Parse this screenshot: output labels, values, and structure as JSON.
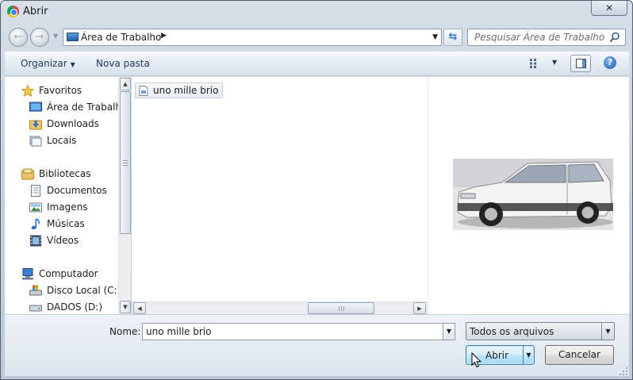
{
  "window": {
    "title": "Abrir",
    "close_label": "✕"
  },
  "address": {
    "location": "Área de Trabalho",
    "search_placeholder": "Pesquisar Área de Trabalho"
  },
  "toolbar": {
    "organize": "Organizar",
    "new_folder": "Nova pasta"
  },
  "tree": {
    "favorites": "Favoritos",
    "desktop": "Área de Trabalho",
    "downloads": "Downloads",
    "places": "Locais",
    "libraries": "Bibliotecas",
    "documents": "Documentos",
    "images": "Imagens",
    "music": "Músicas",
    "videos": "Vídeos",
    "computer": "Computador",
    "local_disk": "Disco Local (C:)",
    "data_disk": "DADOS (D:)"
  },
  "files": [
    {
      "name": "uno mille brio"
    }
  ],
  "bottom": {
    "name_label": "Nome:",
    "name_value": "uno mille brio",
    "filter": "Todos os arquivos",
    "open_button": "Abrir",
    "cancel_button": "Cancelar"
  },
  "colors": {
    "accent": "#3c7fb1",
    "window_frame": "#c3cfdc",
    "toolbar_text": "#1e395b"
  }
}
